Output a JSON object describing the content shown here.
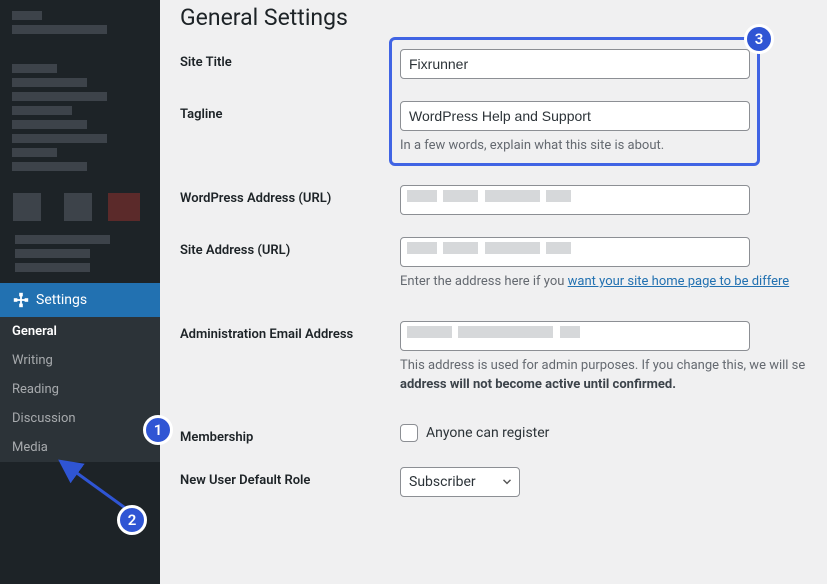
{
  "sidebar": {
    "settings_label": "Settings",
    "submenu": [
      "General",
      "Writing",
      "Reading",
      "Discussion",
      "Media"
    ],
    "active_submenu": 0
  },
  "page": {
    "title": "General Settings"
  },
  "fields": {
    "site_title": {
      "label": "Site Title",
      "value": "Fixrunner"
    },
    "tagline": {
      "label": "Tagline",
      "value": "WordPress Help and Support",
      "help": "In a few words, explain what this site is about."
    },
    "wp_url": {
      "label": "WordPress Address (URL)"
    },
    "site_url": {
      "label": "Site Address (URL)",
      "help_pre": "Enter the address here if you ",
      "help_link": "want your site home page to be differe"
    },
    "admin_email": {
      "label": "Administration Email Address",
      "help_pre": "This address is used for admin purposes. If you change this, we will se",
      "help_strong": "address will not become active until confirmed."
    },
    "membership": {
      "label": "Membership",
      "checkbox_label": "Anyone can register"
    },
    "default_role": {
      "label": "New User Default Role",
      "value": "Subscriber"
    }
  },
  "annotations": {
    "1": "1",
    "2": "2",
    "3": "3"
  }
}
